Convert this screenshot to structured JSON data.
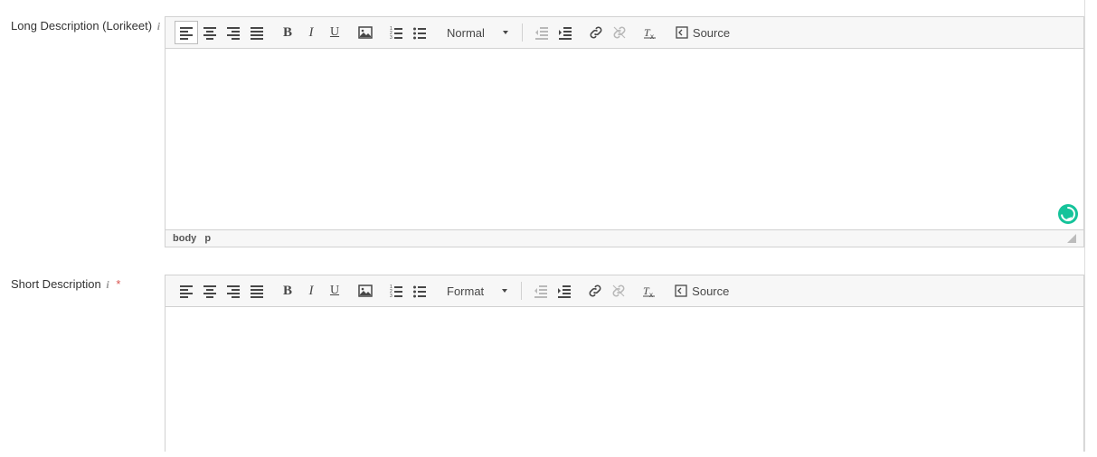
{
  "fields": {
    "long_desc": {
      "label": "Long Description (Lorikeet)",
      "required": false,
      "format_selected": "Normal",
      "source_label": "Source",
      "path": [
        "body",
        "p"
      ]
    },
    "short_desc": {
      "label": "Short Description",
      "required": true,
      "format_selected": "Format",
      "source_label": "Source"
    }
  },
  "icons": {
    "align_left": "align-left-icon",
    "align_center": "align-center-icon",
    "align_right": "align-right-icon",
    "justify": "align-justify-icon",
    "bold": "bold-icon",
    "italic": "italic-icon",
    "underline": "underline-icon",
    "image": "image-icon",
    "ol": "numbered-list-icon",
    "ul": "bullet-list-icon",
    "outdent": "outdent-icon",
    "indent": "indent-icon",
    "link": "link-icon",
    "unlink": "unlink-icon",
    "remove_format": "remove-format-icon",
    "source": "source-icon"
  }
}
